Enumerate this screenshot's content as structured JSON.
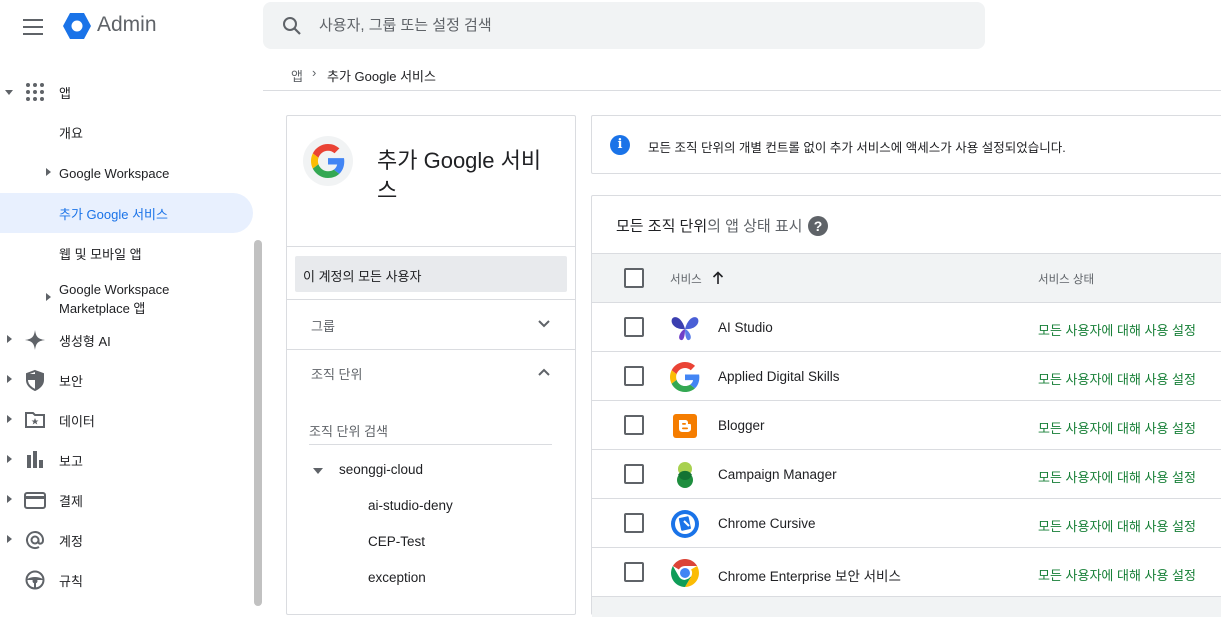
{
  "header": {
    "brand": "Admin",
    "search_placeholder": "사용자, 그룹 또는 설정 검색"
  },
  "sidebar": {
    "items": [
      {
        "label": "앱",
        "icon": "apps-grid-icon",
        "expanded": true
      },
      {
        "label": "개요"
      },
      {
        "label": "Google Workspace"
      },
      {
        "label": "추가 Google 서비스",
        "active": true
      },
      {
        "label": "웹 및 모바일 앱"
      },
      {
        "label_line1": "Google Workspace",
        "label_line2": "Marketplace 앱"
      },
      {
        "label": "생성형 AI",
        "icon": "sparkle-icon"
      },
      {
        "label": "보안",
        "icon": "shield-icon"
      },
      {
        "label": "데이터",
        "icon": "folder-star-icon"
      },
      {
        "label": "보고",
        "icon": "bar-chart-icon"
      },
      {
        "label": "결제",
        "icon": "credit-card-icon"
      },
      {
        "label": "계정",
        "icon": "at-sign-icon"
      },
      {
        "label": "규칙",
        "icon": "steering-wheel-icon"
      }
    ]
  },
  "breadcrumb": {
    "parent": "앱",
    "current": "추가 Google 서비스"
  },
  "left_panel": {
    "title": "추가 Google 서비스",
    "all_users": "이 계정의 모든 사용자",
    "groups_label": "그룹",
    "org_units_label": "조직 단위",
    "org_search_placeholder": "조직 단위 검색",
    "tree": {
      "root": "seonggi-cloud",
      "children": [
        "ai-studio-deny",
        "CEP-Test",
        "exception"
      ]
    }
  },
  "info_banner": {
    "text": "모든 조직 단위의 개별 컨트롤 없이 추가 서비스에 액세스가 사용 설정되었습니다."
  },
  "services_card": {
    "title_bold": "모든 조직 단위",
    "title_rest": "의 앱 상태 표시",
    "help": "?",
    "columns": {
      "service": "서비스",
      "status": "서비스 상태"
    },
    "rows": [
      {
        "name": "AI Studio",
        "status": "모든 사용자에 대해 사용 설정",
        "icon": "ai-studio-icon"
      },
      {
        "name": "Applied Digital Skills",
        "status": "모든 사용자에 대해 사용 설정",
        "icon": "google-g-icon"
      },
      {
        "name": "Blogger",
        "status": "모든 사용자에 대해 사용 설정",
        "icon": "blogger-icon"
      },
      {
        "name": "Campaign Manager",
        "status": "모든 사용자에 대해 사용 설정",
        "icon": "campaign-manager-icon"
      },
      {
        "name": "Chrome Cursive",
        "status": "모든 사용자에 대해 사용 설정",
        "icon": "chrome-cursive-icon"
      },
      {
        "name": "Chrome Enterprise 보안 서비스",
        "status": "모든 사용자에 대해 사용 설정",
        "icon": "chrome-icon"
      }
    ]
  },
  "colors": {
    "accent": "#1a73e8",
    "status_green": "#188038",
    "active_bg": "#e8f0fe"
  }
}
